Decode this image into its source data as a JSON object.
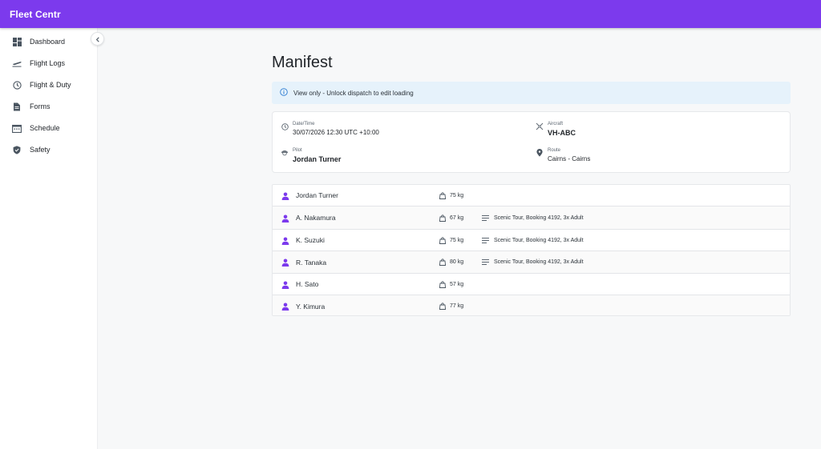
{
  "app": {
    "title": "Fleet Centr"
  },
  "sidebar": {
    "items": [
      {
        "label": "Dashboard",
        "icon": "dashboard-icon"
      },
      {
        "label": "Flight Logs",
        "icon": "takeoff-icon"
      },
      {
        "label": "Flight & Duty",
        "icon": "clock-icon"
      },
      {
        "label": "Forms",
        "icon": "document-icon"
      },
      {
        "label": "Schedule",
        "icon": "calendar-icon"
      },
      {
        "label": "Safety",
        "icon": "shield-icon"
      }
    ],
    "collapse_icon": "chevron-left-icon"
  },
  "page": {
    "title": "Manifest"
  },
  "alert": {
    "text": "View only - Unlock dispatch to edit loading",
    "icon": "info-icon"
  },
  "flight_info": {
    "datetime": {
      "label": "Date/Time",
      "value": "30/07/2026 12:30 UTC +10:00",
      "icon": "clock-icon"
    },
    "aircraft": {
      "label": "Aircraft",
      "value": "VH-ABC",
      "icon": "airplane-icon"
    },
    "pilot": {
      "label": "Pilot",
      "value": "Jordan Turner",
      "icon": "pilot-icon"
    },
    "route": {
      "label": "Route",
      "value": "Cairns - Cairns",
      "icon": "location-pin-icon"
    }
  },
  "manifest": {
    "rows": [
      {
        "name": "Jordan Turner",
        "weight": "75 kg",
        "notes": ""
      },
      {
        "name": "A. Nakamura",
        "weight": "67 kg",
        "notes": "Scenic Tour, Booking 4192, 3x Adult"
      },
      {
        "name": "K. Suzuki",
        "weight": "75 kg",
        "notes": "Scenic Tour, Booking 4192, 3x Adult"
      },
      {
        "name": "R. Tanaka",
        "weight": "80 kg",
        "notes": "Scenic Tour, Booking 4192, 3x Adult"
      },
      {
        "name": "H. Sato",
        "weight": "57 kg",
        "notes": ""
      },
      {
        "name": "Y. Kimura",
        "weight": "77 kg",
        "notes": ""
      }
    ]
  },
  "colors": {
    "brand": "#7c3aed",
    "person_icon": "#7c3aed",
    "alert_bg": "#e6f2fb"
  }
}
